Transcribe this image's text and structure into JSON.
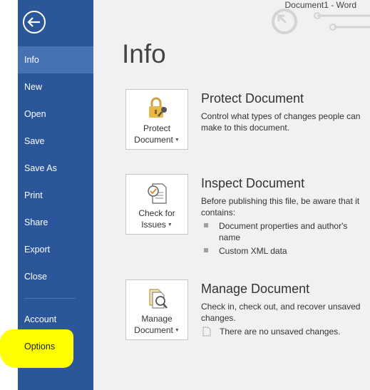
{
  "window": {
    "title": "Document1 - Word"
  },
  "sidebar": {
    "back_icon": "back-arrow-icon",
    "items": [
      {
        "label": "Info",
        "active": true
      },
      {
        "label": "New"
      },
      {
        "label": "Open"
      },
      {
        "label": "Save"
      },
      {
        "label": "Save As"
      },
      {
        "label": "Print"
      },
      {
        "label": "Share"
      },
      {
        "label": "Export"
      },
      {
        "label": "Close"
      },
      {
        "label": "Account"
      },
      {
        "label": "Options",
        "highlighted": true
      }
    ],
    "bg_color": "#2b579a",
    "active_color": "#4672b3",
    "highlight_color": "#ffff00"
  },
  "main": {
    "title": "Info",
    "sections": [
      {
        "tile_label_line1": "Protect",
        "tile_label_line2": "Document",
        "tile_icon": "lock-key-icon",
        "title": "Protect Document",
        "description": "Control what types of changes people can make to this document."
      },
      {
        "tile_label_line1": "Check for",
        "tile_label_line2": "Issues",
        "tile_icon": "inspect-document-icon",
        "title": "Inspect Document",
        "description": "Before publishing this file, be aware that it contains:",
        "bullets": [
          "Document properties and author's name",
          "Custom XML data"
        ]
      },
      {
        "tile_label_line1": "Manage",
        "tile_label_line2": "Document",
        "tile_icon": "manage-document-icon",
        "title": "Manage Document",
        "description": "Check in, check out, and recover unsaved changes.",
        "status": "There are no unsaved changes."
      }
    ]
  }
}
